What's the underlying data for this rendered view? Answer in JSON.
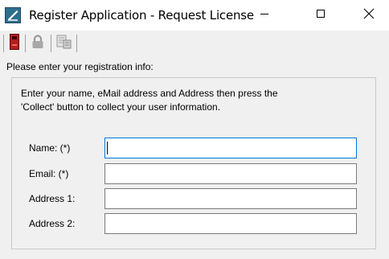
{
  "window": {
    "title": "Register Application - Request License",
    "controls": {
      "minimize": "minimize",
      "maximize": "maximize",
      "close": "close"
    }
  },
  "toolbar": {
    "buttons": [
      {
        "icon": "red-device-icon",
        "enabled": true
      },
      {
        "icon": "lock-icon",
        "enabled": false
      },
      {
        "icon": "collect-info-icon",
        "enabled": false
      }
    ]
  },
  "section": {
    "label": "Please enter your registration info:",
    "instructions": "Enter your name, eMail address and Address then press the\n'Collect' button to collect your user information."
  },
  "form": {
    "fields": [
      {
        "label": "Name: (*)",
        "value": "",
        "placeholder": ""
      },
      {
        "label": "Email: (*)",
        "value": "",
        "placeholder": ""
      },
      {
        "label": "Address 1:",
        "value": "",
        "placeholder": ""
      },
      {
        "label": "Address 2:",
        "value": "",
        "placeholder": ""
      }
    ]
  },
  "colors": {
    "window_bg": "#f0f0f0",
    "focus_border": "#0078d7",
    "input_border": "#7a7a7a"
  }
}
